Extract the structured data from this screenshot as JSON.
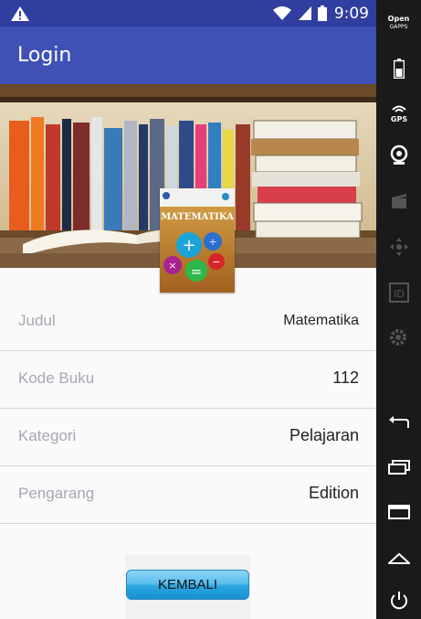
{
  "statusbar": {
    "time": "9:09"
  },
  "appbar": {
    "title": "Login"
  },
  "book": {
    "cover_title": "MATEMATIKA"
  },
  "details": [
    {
      "label": "Judul",
      "value": "Matematika"
    },
    {
      "label": "Kode Buku",
      "value": "112"
    },
    {
      "label": "Kategori",
      "value": "Pelajaran"
    },
    {
      "label": "Pengarang",
      "value": "Edition"
    }
  ],
  "actions": {
    "back_label": "KEMBALI"
  },
  "emulator_sidebar": {
    "brand_top": "Open",
    "brand_bottom": "GAPPS",
    "gps_label": "GPS",
    "id_label": "ID"
  },
  "colors": {
    "primary": "#3f51b5",
    "primary_dark": "#303f9f",
    "button": "#2aa6e2"
  }
}
